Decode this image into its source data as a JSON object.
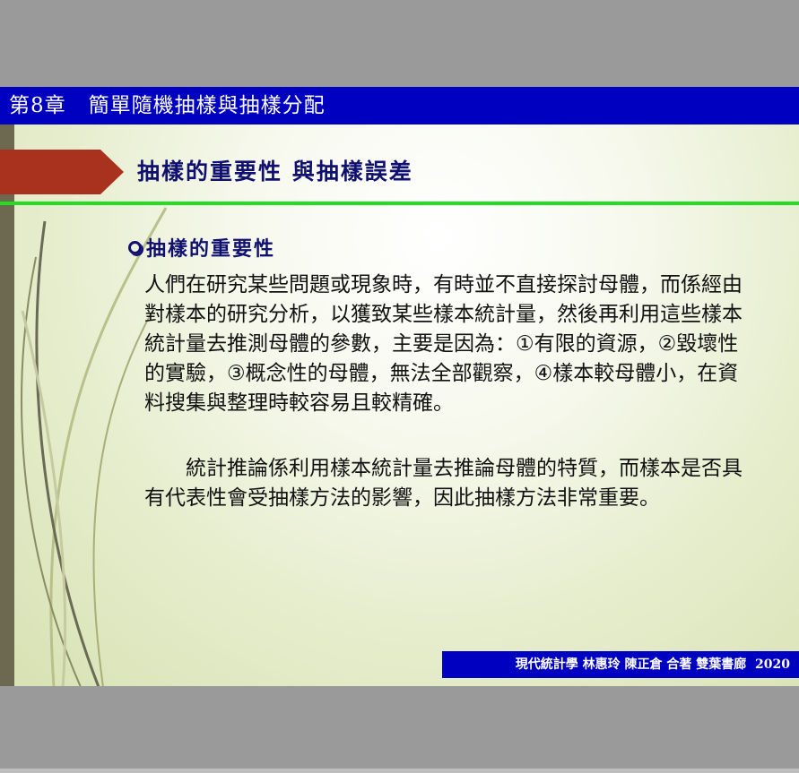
{
  "chapter": {
    "title": "第8章   簡單隨機抽樣與抽樣分配"
  },
  "section": {
    "title": "抽樣的重要性 與抽樣誤差"
  },
  "bullet": {
    "heading": "抽樣的重要性"
  },
  "body": {
    "paragraph1": "人們在研究某些問題或現象時，有時並不直接探討母體，而係經由對樣本的研究分析，以獲致某些樣本統計量，然後再利用這些樣本統計量去推測母體的參數，主要是因為：①有限的資源，②毀壞性的實驗，③概念性的母體，無法全部觀察，④樣本較母體小，在資料搜集與整理時較容易且較精確。",
    "paragraph2": "　　統計推論係利用樣本統計量去推論母體的特質，而樣本是否具有代表性會受抽樣方法的影響，因此抽樣方法非常重要。"
  },
  "footer": {
    "text": "現代統計學 林惠玲 陳正倉 合著 雙葉書廊  2020"
  },
  "colors": {
    "title_bar": "#0000c0",
    "accent_green": "#22dd22",
    "arrow_red": "#a8321e",
    "heading_navy": "#101070"
  }
}
